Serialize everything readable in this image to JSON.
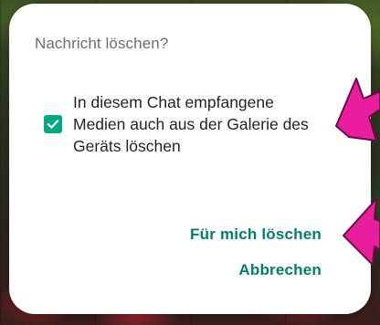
{
  "dialog": {
    "title": "Nachricht löschen?",
    "checkbox": {
      "checked": true,
      "label": "In diesem Chat empfangene Medien auch aus der Galerie des Geräts löschen"
    },
    "actions": {
      "delete_for_me": "Für mich löschen",
      "cancel": "Abbrechen"
    }
  },
  "colors": {
    "accent": "#008069",
    "checkbox": "#00a884",
    "annotation_arrow": "#e91e9e"
  },
  "icons": {
    "checkbox": "check-icon",
    "annotations": [
      "arrow-pointer-icon",
      "arrow-pointer-icon"
    ]
  }
}
